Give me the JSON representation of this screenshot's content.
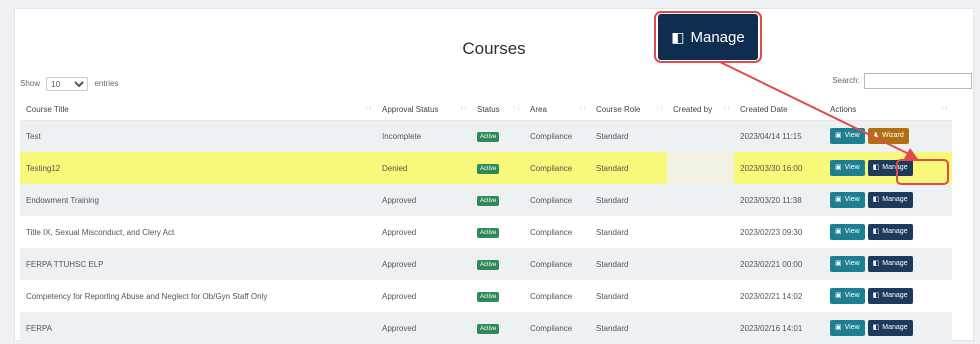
{
  "header": {
    "title": "Courses"
  },
  "length": {
    "show_label": "Show",
    "selected": "10",
    "entries_label": "entries"
  },
  "search": {
    "label": "Search:",
    "value": ""
  },
  "columns": [
    "Course Title",
    "Approval Status",
    "Status",
    "Area",
    "Course Role",
    "Created by",
    "Created Date",
    "Actions"
  ],
  "rows": [
    {
      "title": "Test",
      "approval": "Incomplete",
      "status": "Active",
      "area": "Compliance",
      "role": "Standard",
      "created_by": "",
      "date": "2023/04/14 11:15",
      "a1": "View",
      "a2": "Wizard"
    },
    {
      "title": "Testing12",
      "approval": "Denied",
      "status": "Active",
      "area": "Compliance",
      "role": "Standard",
      "created_by": "",
      "date": "2023/03/30 16:00",
      "a1": "View",
      "a2": "Manage"
    },
    {
      "title": "Endowment Training",
      "approval": "Approved",
      "status": "Active",
      "area": "Compliance",
      "role": "Standard",
      "created_by": "",
      "date": "2023/03/20 11:38",
      "a1": "View",
      "a2": "Manage"
    },
    {
      "title": "Title IX, Sexual Misconduct, and Clery Act",
      "approval": "Approved",
      "status": "Active",
      "area": "Compliance",
      "role": "Standard",
      "created_by": "",
      "date": "2023/02/23 09:30",
      "a1": "View",
      "a2": "Manage"
    },
    {
      "title": "FERPA TTUHSC ELP",
      "approval": "Approved",
      "status": "Active",
      "area": "Compliance",
      "role": "Standard",
      "created_by": "",
      "date": "2023/02/21 00:00",
      "a1": "View",
      "a2": "Manage"
    },
    {
      "title": "Competency for Reporting Abuse and Neglect for Ob/Gyn Staff Only",
      "approval": "Approved",
      "status": "Active",
      "area": "Compliance",
      "role": "Standard",
      "created_by": "",
      "date": "2023/02/21 14:02",
      "a1": "View",
      "a2": "Manage"
    },
    {
      "title": "FERPA",
      "approval": "Approved",
      "status": "Active",
      "area": "Compliance",
      "role": "Standard",
      "created_by": "",
      "date": "2023/02/16 14:01",
      "a1": "View",
      "a2": "Manage"
    }
  ],
  "callout": {
    "label": "Manage",
    "icon": "edit-icon",
    "outline_color": "#e24a4a"
  },
  "colors": {
    "view": "#1d7f92",
    "manage": "#1c3a5e",
    "wizard": "#b06f12",
    "active": "#2d8a57",
    "highlight": "#f8f87a"
  }
}
